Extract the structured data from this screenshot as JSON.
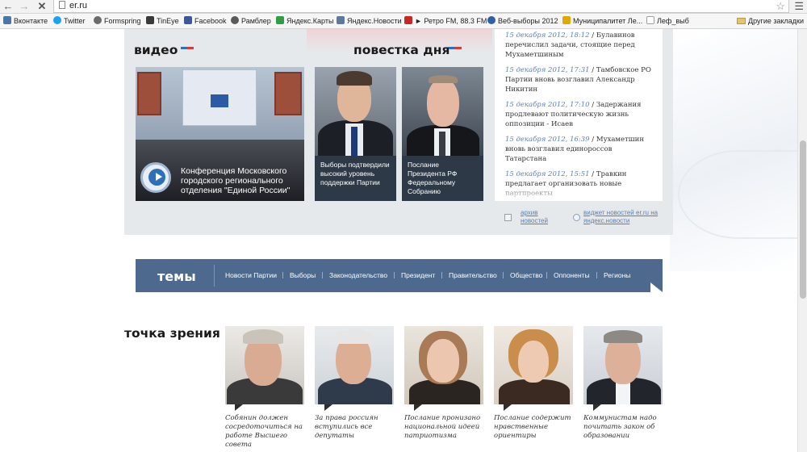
{
  "browser": {
    "url": "er.ru",
    "back_icon": "arrow-left-icon",
    "forward_icon": "arrow-right-icon",
    "close_icon": "x-icon",
    "star_icon": "star-icon",
    "menu_icon": "hamburger-icon"
  },
  "bookmarks": [
    {
      "label": "Вконтакте",
      "color": "#4a76a8"
    },
    {
      "label": "Twitter",
      "color": "#1da1f2"
    },
    {
      "label": "Formspring",
      "color": "#6b6b6b"
    },
    {
      "label": "TinEye",
      "color": "#3a3a3a"
    },
    {
      "label": "Facebook",
      "color": "#3b5998"
    },
    {
      "label": "Рамблер",
      "color": "#5a5a5a"
    },
    {
      "label": "Яндекс.Карты",
      "color": "#2f9e44"
    },
    {
      "label": "Яндекс.Новости",
      "color": "#5b7a9e"
    },
    {
      "label": "► Ретро FM, 88.3 FM",
      "color": "#c62828"
    },
    {
      "label": "Веб-выборы 2012",
      "color": "#2e5fa8"
    },
    {
      "label": "Муниципалитет Ле...",
      "color": "#e0a800"
    },
    {
      "label": "Леф_выб",
      "color": "#9e9e9e"
    }
  ],
  "bookmarks_other": "Другие закладки",
  "sections": {
    "video_title": "видео",
    "agenda_title": "повестка дня",
    "topics_title": "темы",
    "opinion_title": "точка зрения"
  },
  "video": {
    "caption": "Конференция Московского городского регионального отделения \"Единой России\""
  },
  "agenda": [
    {
      "caption": "Выборы подтвердили высокий уровень поддержки Партии"
    },
    {
      "caption": "Послание Президента РФ Федеральному Собранию"
    }
  ],
  "news": [
    {
      "date": "15 декабря 2012, 18:12",
      "text": "Булавинов перечислил задачи, стоящие перед Мухаметшиным"
    },
    {
      "date": "15 декабря 2012, 17:31",
      "text": "Тамбовское РО Партии вновь возглавил Александр Никитин"
    },
    {
      "date": "15 декабря 2012, 17:10",
      "text": "Задержания продлевают политическую жизнь оппозиции - Исаев"
    },
    {
      "date": "15 декабря 2012, 16:39",
      "text": "Мухаметшин вновь возглавил единороссов Татарстана"
    },
    {
      "date": "15 декабря 2012, 15:51",
      "text": "Травкин предлагает организовать новые партпроекты"
    }
  ],
  "news_links": {
    "archive": "архив новостей",
    "widget": "виджет новостей er.ru на яндекс.новости"
  },
  "topics": [
    "Новости Партии",
    "Выборы",
    "Законодательство",
    "Президент",
    "Правительство",
    "Общество",
    "Оппоненты",
    "Регионы"
  ],
  "opinions": [
    {
      "caption": "Собянин должен сосредоточиться на работе Высшего совета"
    },
    {
      "caption": "За права россиян вступились все депутаты"
    },
    {
      "caption": "Послание пронизано национальной идеей патриотизма"
    },
    {
      "caption": "Послание содержит нравственные ориентиры"
    },
    {
      "caption": "Коммунистам надо почитать закон об образовании"
    }
  ],
  "colors": {
    "topics_bar": "#4d6a8e",
    "panel": "#e6e9ec",
    "news_date": "#5c7fb0",
    "flag_blue": "#2f6fb7",
    "flag_red": "#d83a3a"
  }
}
